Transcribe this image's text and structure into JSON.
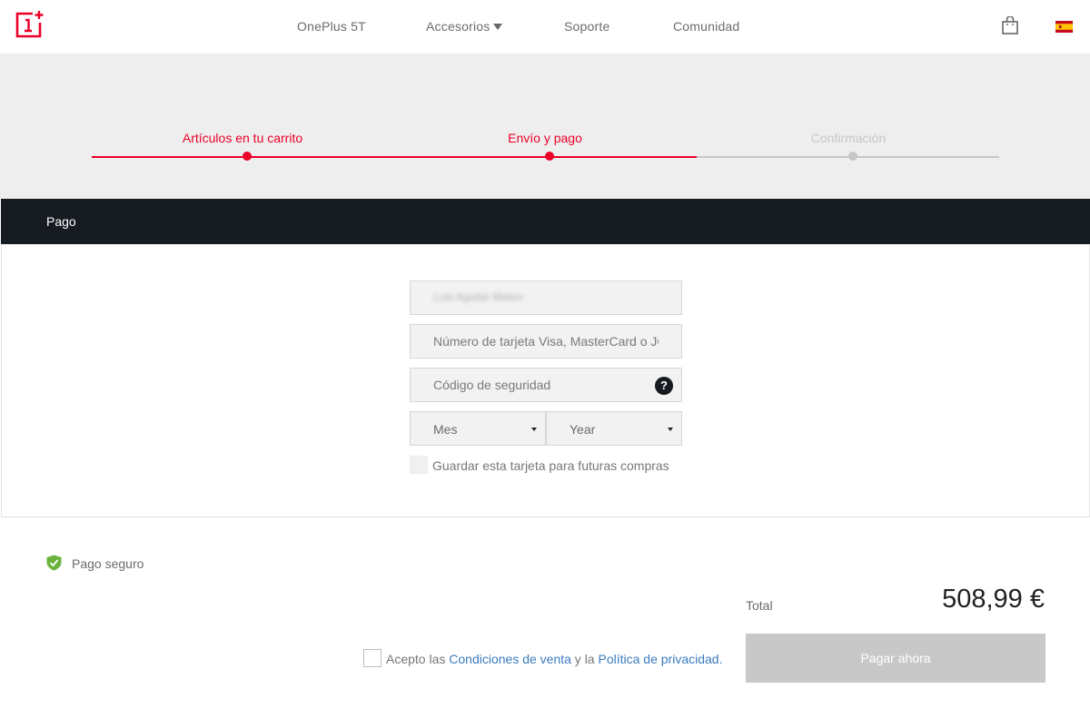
{
  "header": {
    "logo_icon": "oneplus-logo-icon",
    "nav": [
      "OnePlus 5T",
      "Accesorios",
      "Soporte",
      "Comunidad"
    ],
    "cart_icon": "shopping-bag-icon",
    "flag_icon": "spain-flag-icon"
  },
  "progress": {
    "steps": [
      "Artículos en tu carrito",
      "Envío y pago",
      "Confirmación"
    ],
    "active_color": "#eb0028",
    "inactive_color": "#c6c6c6"
  },
  "section": {
    "title": "Pago"
  },
  "form": {
    "name_value_blurred": "Luis Aguilar Mateo",
    "card_number_placeholder": "Número de tarjeta Visa, MasterCard o JCB",
    "security_code_placeholder": "Código de seguridad",
    "help_symbol": "?",
    "month_select": "Mes",
    "year_select": "Year",
    "save_card_label": "Guardar esta tarjeta para futuras compras"
  },
  "footer": {
    "secure_label": "Pago seguro",
    "total_label": "Total",
    "total_value": "508,99 €",
    "terms_prefix": "Acepto las ",
    "terms_link1": "Condiciones de venta",
    "terms_middle": " y la ",
    "terms_link2": "Política de privacidad",
    "terms_suffix": ".",
    "pay_button": "Pagar ahora"
  }
}
